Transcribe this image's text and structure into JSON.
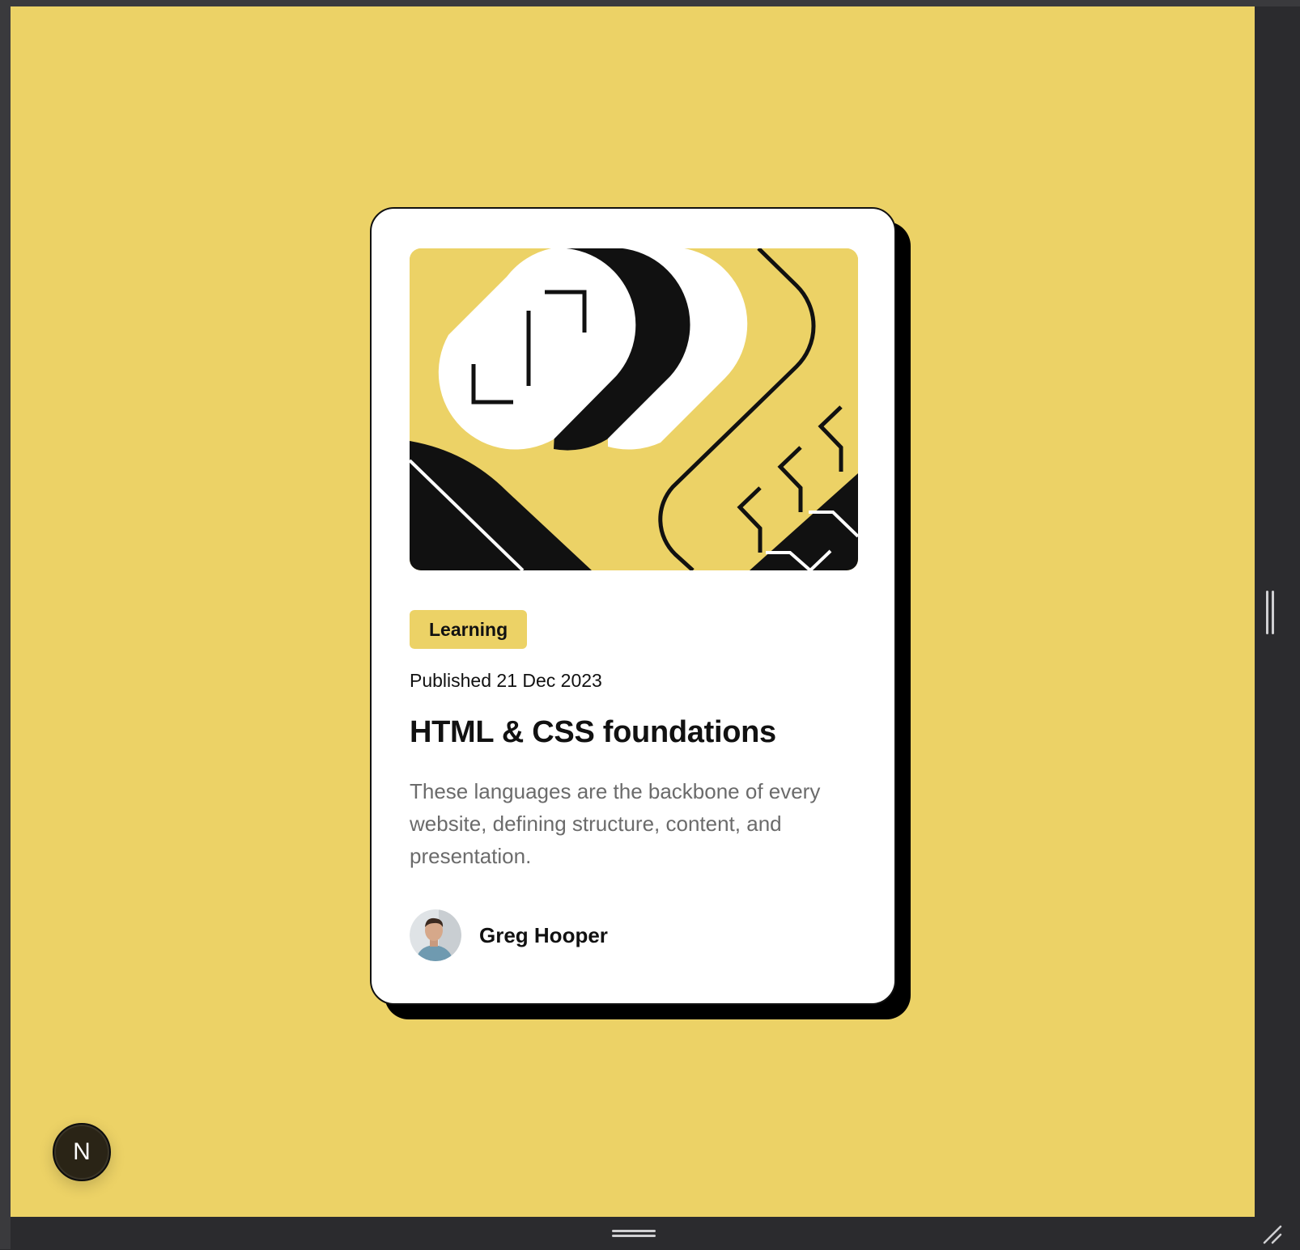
{
  "colors": {
    "background": "#ecd266",
    "card": "#ffffff",
    "ink": "#111111",
    "muted_text": "#6b6b6b",
    "tag_background": "#ecd266",
    "chrome": "#2b2b2e"
  },
  "card": {
    "tag": "Learning",
    "published": "Published 21 Dec 2023",
    "title": "HTML & CSS foundations",
    "description": "These languages are the backbone of every website, defining structure, content, and presentation.",
    "author": {
      "name": "Greg Hooper"
    }
  },
  "dev_badge": {
    "label": "N",
    "icon": "nextjs-logo-icon"
  }
}
